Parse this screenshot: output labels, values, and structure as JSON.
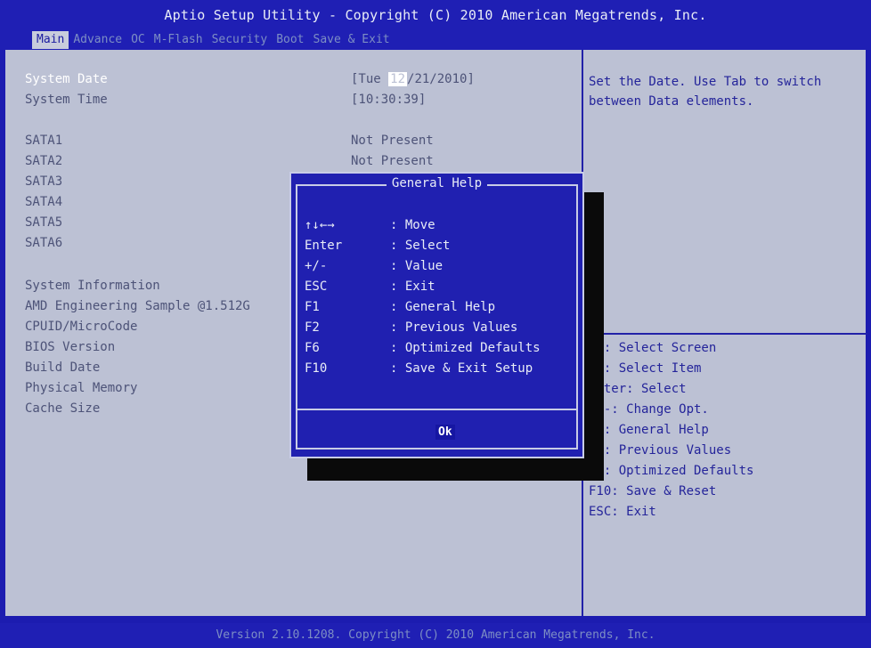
{
  "header": {
    "title": "Aptio Setup Utility - Copyright (C) 2010 American Megatrends, Inc.",
    "tabs": [
      "Main",
      "Advance",
      "OC",
      "M-Flash",
      "Security",
      "Boot",
      "Save & Exit"
    ],
    "active_tab": "Main"
  },
  "main": {
    "system_date": {
      "label": "System Date",
      "value_prefix": "[Tue ",
      "value_selected": "12",
      "value_suffix": "/21/2010]"
    },
    "system_time": {
      "label": "System Time",
      "value": "[10:30:39]"
    },
    "sata": [
      {
        "label": "SATA1",
        "value": "Not Present"
      },
      {
        "label": "SATA2",
        "value": "Not Present"
      },
      {
        "label": "SATA3",
        "value": ""
      },
      {
        "label": "SATA4",
        "value": ""
      },
      {
        "label": "SATA5",
        "value": ""
      },
      {
        "label": "SATA6",
        "value": ""
      }
    ],
    "system_information": "System Information",
    "info_rows": [
      "AMD Engineering Sample @1.512G",
      "CPUID/MicroCode",
      "BIOS Version",
      "Build Date",
      "Physical Memory",
      "Cache Size"
    ]
  },
  "help_panel": {
    "text": "Set the Date. Use Tab to switch between Data elements.",
    "keys": [
      "→←: Select Screen",
      "↑↓: Select Item",
      "Enter: Select",
      "+/-: Change Opt.",
      "F1: General Help",
      "F2: Previous Values",
      "F6: Optimized Defaults",
      "F10: Save & Reset",
      "ESC: Exit"
    ]
  },
  "dialog": {
    "title": "General Help",
    "rows": [
      {
        "key": "↑↓←→",
        "action": ": Move"
      },
      {
        "key": "Enter",
        "action": ": Select"
      },
      {
        "key": "+/-",
        "action": ": Value"
      },
      {
        "key": "ESC",
        "action": ": Exit"
      },
      {
        "key": "F1",
        "action": ": General Help"
      },
      {
        "key": "F2",
        "action": ": Previous Values"
      },
      {
        "key": "F6",
        "action": ": Optimized Defaults"
      },
      {
        "key": "F10",
        "action": ": Save & Exit Setup"
      }
    ],
    "ok_label": "Ok"
  },
  "footer": {
    "text": "Version 2.10.1208. Copyright (C) 2010 American Megatrends, Inc."
  }
}
